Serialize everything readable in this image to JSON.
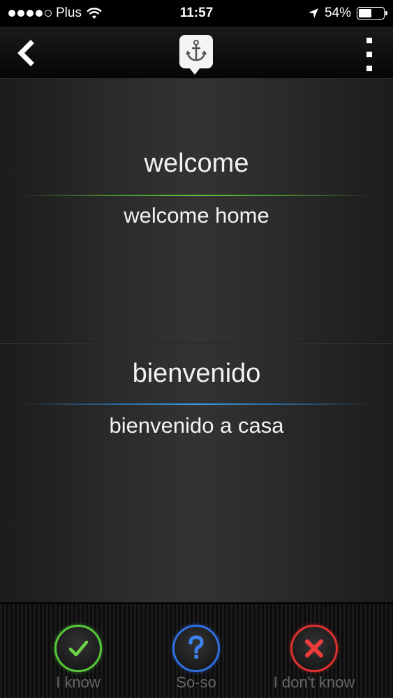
{
  "status_bar": {
    "carrier": "Plus",
    "time": "11:57",
    "battery_percent": "54%",
    "battery_level": 0.54,
    "signal_bars_filled": 4,
    "icons": [
      "wifi-icon",
      "location-arrow-icon",
      "battery-icon"
    ]
  },
  "nav": {
    "back_icon": "chevron-left-icon",
    "logo_icon": "anchor-speech-bubble-icon",
    "menu_icon": "vertical-more-icon"
  },
  "cards": {
    "source": {
      "word": "welcome",
      "phrase": "welcome home",
      "accent": "#6bc140"
    },
    "target": {
      "word": "bienvenido",
      "phrase": "bienvenido a casa",
      "accent": "#3d9be0"
    }
  },
  "toolbar": {
    "know": {
      "label": "I know",
      "icon": "check-icon",
      "color": "#56c83a"
    },
    "soso": {
      "label": "So-so",
      "icon": "question-icon",
      "color": "#2f6fe0"
    },
    "dont_know": {
      "label": "I don't know",
      "icon": "x-icon",
      "color": "#e03030"
    }
  }
}
